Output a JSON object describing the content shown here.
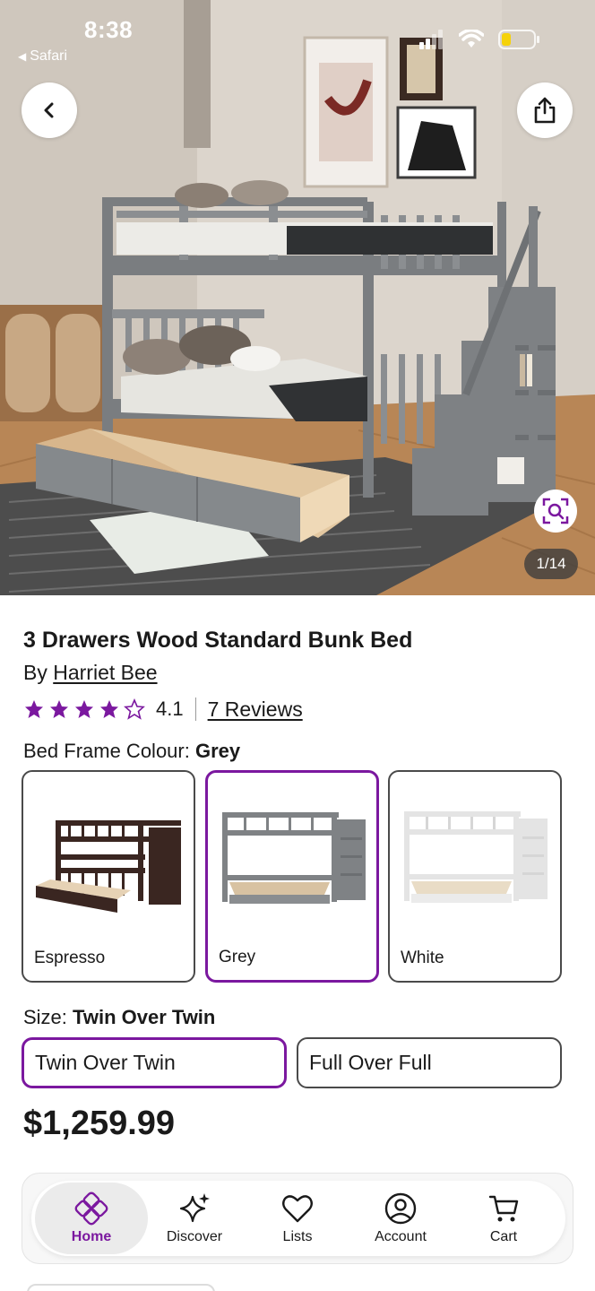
{
  "status_bar": {
    "time": "8:38",
    "back_app": "Safari"
  },
  "hero": {
    "image_counter": "1/14"
  },
  "product": {
    "title": "3 Drawers Wood Standard Bunk Bed",
    "by_prefix": "By",
    "brand": "Harriet Bee",
    "rating": {
      "value": 4.1,
      "value_text": "4.1",
      "max": 5,
      "reviews_label": "7 Reviews"
    },
    "colour_option": {
      "label": "Bed Frame Colour:",
      "selected": "Grey",
      "choices": [
        "Espresso",
        "Grey",
        "White"
      ]
    },
    "size_option": {
      "label": "Size:",
      "selected": "Twin Over Twin",
      "choices": [
        "Twin Over Twin",
        "Full Over Full"
      ]
    },
    "price": "$1,259.99"
  },
  "nav": {
    "items": [
      {
        "label": "Home",
        "icon": "home-icon",
        "active": true
      },
      {
        "label": "Discover",
        "icon": "sparkle-icon",
        "active": false
      },
      {
        "label": "Lists",
        "icon": "heart-icon",
        "active": false
      },
      {
        "label": "Account",
        "icon": "account-icon",
        "active": false
      },
      {
        "label": "Cart",
        "icon": "cart-icon",
        "active": false
      }
    ]
  },
  "colors": {
    "accent": "#7b189f",
    "star": "#7b189f",
    "text": "#1a1a1a",
    "border": "#4a4a4a"
  }
}
